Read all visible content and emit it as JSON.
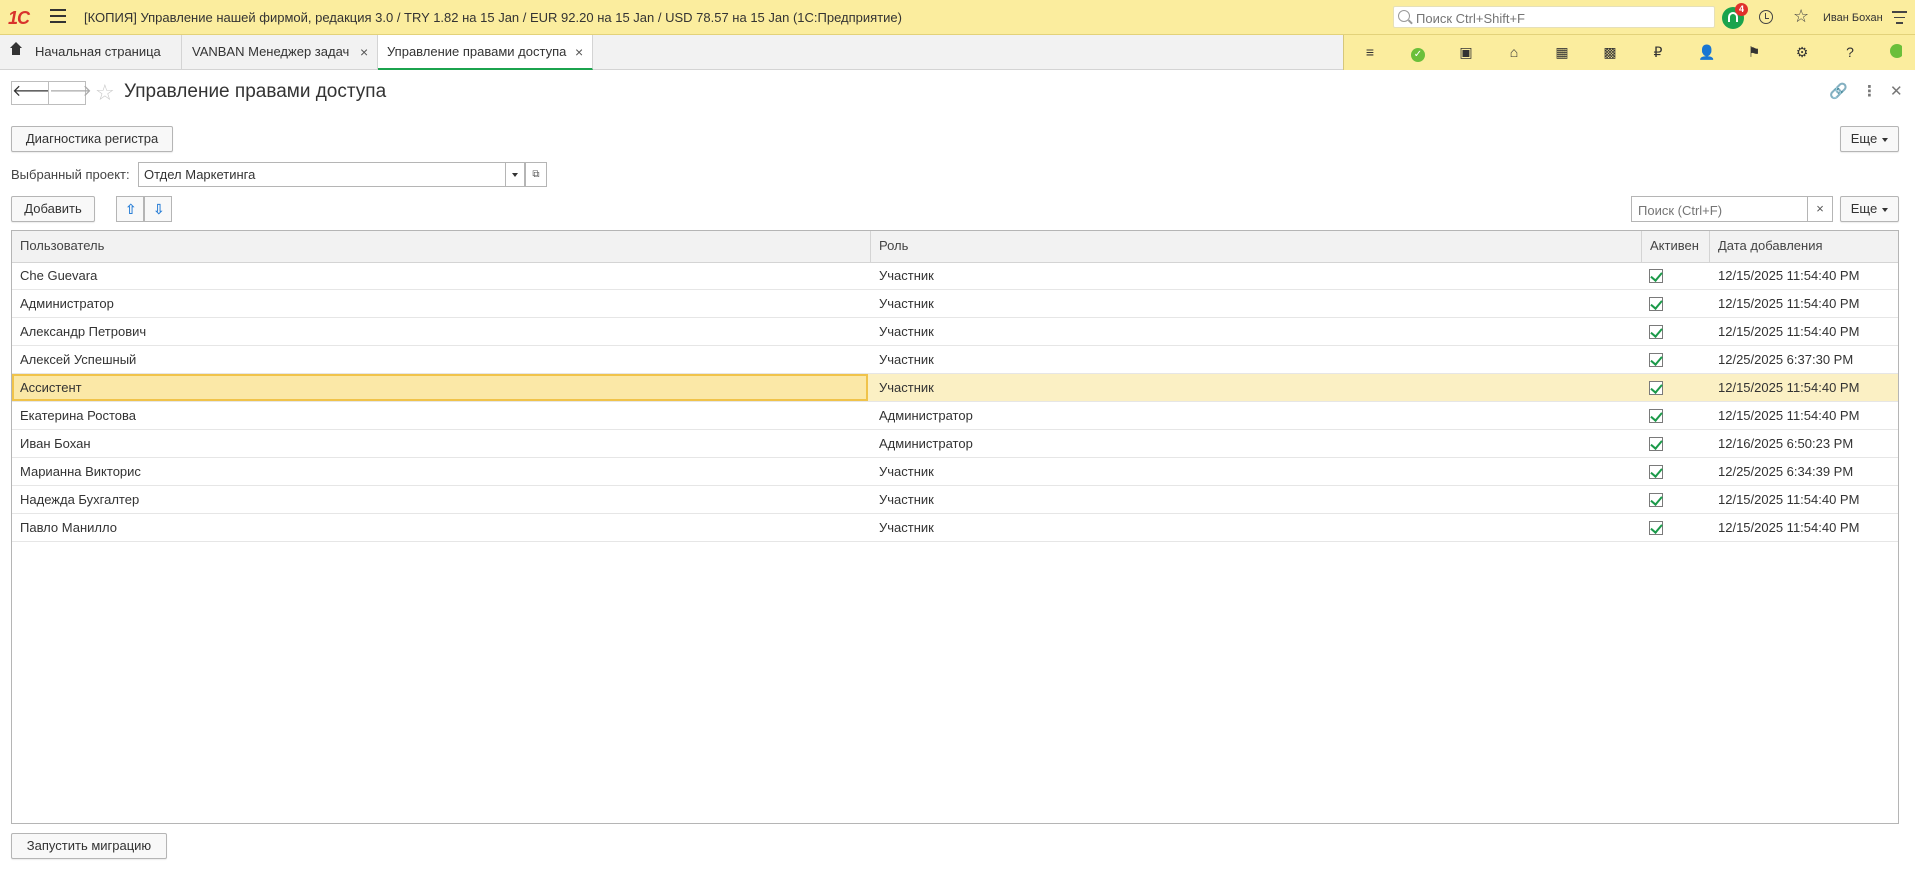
{
  "app": {
    "logo": "1С",
    "title": "[КОПИЯ] Управление нашей фирмой, редакция 3.0 / TRY 1.82 на 15 Jan / EUR 92.20 на 15 Jan / USD 78.57 на 15 Jan  (1С:Предприятие)",
    "search_placeholder": "Поиск Ctrl+Shift+F",
    "notifications_count": "4",
    "user": "Иван Бохан"
  },
  "tabs": [
    {
      "label": "Начальная страница"
    },
    {
      "label": "VANBAN Менеджер задач"
    },
    {
      "label": "Управление правами доступа"
    }
  ],
  "toolpanel_icons": [
    "list-icon",
    "check-circle-icon",
    "cash-register-icon",
    "bank-icon",
    "warehouse-icon",
    "grid-icon",
    "ruble-icon",
    "users-icon",
    "flag-icon",
    "gear-icon",
    "help-icon"
  ],
  "form": {
    "title": "Управление правами доступа",
    "diag_button": "Диагностика регистра",
    "more_button": "Еще",
    "project_label": "Выбранный проект:",
    "project_value": "Отдел Маркетинга",
    "add_button": "Добавить",
    "search_placeholder": "Поиск (Ctrl+F)",
    "more_button2": "Еще",
    "migrate_button": "Запустить миграцию"
  },
  "table": {
    "columns": [
      "Пользователь",
      "Роль",
      "Активен",
      "Дата добавления"
    ],
    "rows": [
      {
        "user": "Che Guevara",
        "role": "Участник",
        "active": true,
        "date": "12/15/2025 11:54:40 PM"
      },
      {
        "user": "Администратор",
        "role": "Участник",
        "active": true,
        "date": "12/15/2025 11:54:40 PM"
      },
      {
        "user": "Александр Петрович",
        "role": "Участник",
        "active": true,
        "date": "12/15/2025 11:54:40 PM"
      },
      {
        "user": "Алексей Успешный",
        "role": "Участник",
        "active": true,
        "date": "12/25/2025 6:37:30 PM"
      },
      {
        "user": "Ассистент",
        "role": "Участник",
        "active": true,
        "date": "12/15/2025 11:54:40 PM",
        "selected": true
      },
      {
        "user": "Екатерина Ростова",
        "role": "Администратор",
        "active": true,
        "date": "12/15/2025 11:54:40 PM"
      },
      {
        "user": "Иван Бохан",
        "role": "Администратор",
        "active": true,
        "date": "12/16/2025 6:50:23 PM"
      },
      {
        "user": "Марианна Викторис",
        "role": "Участник",
        "active": true,
        "date": "12/25/2025 6:34:39 PM"
      },
      {
        "user": "Надежда Бухгалтер",
        "role": "Участник",
        "active": true,
        "date": "12/15/2025 11:54:40 PM"
      },
      {
        "user": "Павло Манилло",
        "role": "Участник",
        "active": true,
        "date": "12/15/2025 11:54:40 PM"
      }
    ]
  },
  "colors": {
    "titlebar": "#fbed9e",
    "accent_green": "#1ba34d",
    "selection": "#fbf0c4"
  }
}
